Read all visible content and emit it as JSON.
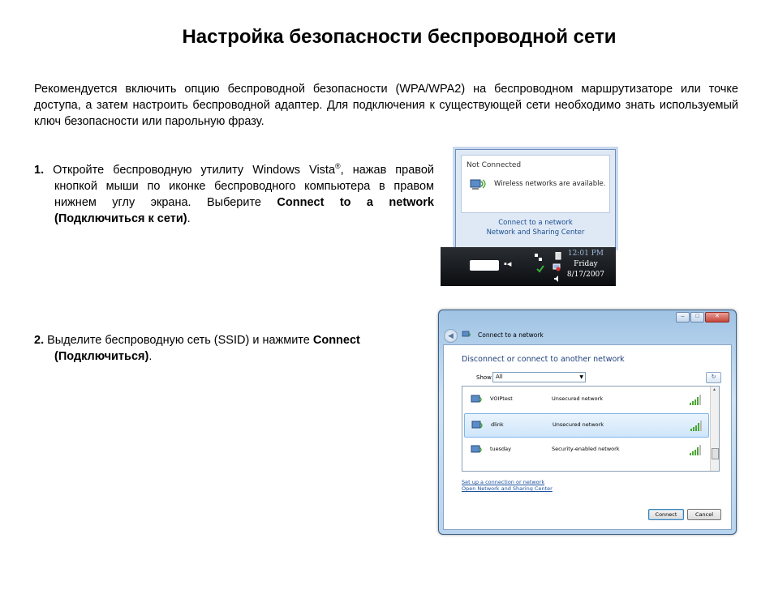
{
  "title": "Настройка безопасности беспроводной сети",
  "intro": "Рекомендуется включить опцию беспроводной безопасности (WPA/WPA2) на беспроводном маршрутизаторе или точке доступа, а затем настроить беспроводной адаптер. Для подключения к существующей сети необходимо знать используемый ключ безопасности или парольную фразу.",
  "step1": {
    "num": "1.",
    "text_a": " Откройте беспроводную утилиту  Windows Vista",
    "reg": "®",
    "text_b": ", нажав правой кнопкой мыши по иконке беспроводного компьютера в правом нижнем углу экрана. Выберите ",
    "bold": "Connect to a network (Подключиться к сети)",
    "end": "."
  },
  "step2": {
    "num": "2.",
    "text_a": " Выделите беспроводную сеть (SSID) и нажмите ",
    "bold": "Connect (Подключиться)",
    "end": "."
  },
  "tray_popup": {
    "status": "Not Connected",
    "message": "Wireless networks are available.",
    "link1": "Connect to a network",
    "link2": "Network and Sharing Center"
  },
  "taskbar": {
    "time": "12:01 PM",
    "day": "Friday",
    "date": "8/17/2007"
  },
  "dialog": {
    "nav_title": "Connect to a network",
    "heading": "Disconnect or connect to another network",
    "show_label": "Show",
    "show_value": "All",
    "networks": [
      {
        "name": "VOIPtest",
        "security": "Unsecured network",
        "signal": 4
      },
      {
        "name": "dlink",
        "security": "Unsecured network",
        "signal": 4
      },
      {
        "name": "tuesday",
        "security": "Security-enabled network",
        "signal": 4
      }
    ],
    "link1": "Set up a connection or network",
    "link2": "Open Network and Sharing Center",
    "connect_label": "Connect",
    "cancel_label": "Cancel"
  }
}
